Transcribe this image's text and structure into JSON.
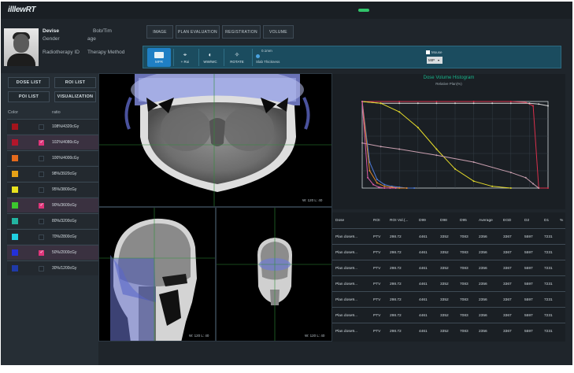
{
  "app": {
    "logo": "illlewRT"
  },
  "patient": {
    "name_label": "Devise",
    "name_value": "Bob/Tim",
    "gender_label": "Gender",
    "age_label": "age",
    "radiotherapy_id_label": "Radiotherapy ID",
    "therapy_method_label": "Therapy Method"
  },
  "nav": [
    "IMAGE",
    "PLAN EVALUATION",
    "REGISTRATION",
    "VOLUME"
  ],
  "toolbar": {
    "tools": [
      {
        "label": "MPR",
        "icon": "layout-icon"
      },
      {
        "label": "+ Roi",
        "icon": "crosshair-icon"
      },
      {
        "label": "WW/WC",
        "icon": "contrast-icon"
      },
      {
        "label": "ROTATE",
        "icon": "rotate-icon"
      }
    ],
    "slab_value": "0.1mm",
    "slab_label": "Slab Thickness",
    "mode_select": "MIP",
    "mouse_label": "Mouse"
  },
  "left": {
    "buttons": [
      "DOSE LIST",
      "ROI LIST",
      "POI LIST",
      "VISUALIZATION"
    ],
    "col_color": "Color",
    "col_ratio": "ratio",
    "dose_rows": [
      {
        "color": "#a4141c",
        "checked": false,
        "label": "108%/4320cGy"
      },
      {
        "color": "#b2162b",
        "checked": true,
        "label": "102%/4080cGy"
      },
      {
        "color": "#e46a1c",
        "checked": false,
        "label": "100%/4000cGy"
      },
      {
        "color": "#e6a117",
        "checked": false,
        "label": "98%/3920cGy"
      },
      {
        "color": "#e8e11e",
        "checked": false,
        "label": "95%/3800cGy"
      },
      {
        "color": "#3cc82e",
        "checked": true,
        "label": "90%/3600cGy"
      },
      {
        "color": "#22b4a0",
        "checked": false,
        "label": "80%/3200cGy"
      },
      {
        "color": "#20cfe0",
        "checked": false,
        "label": "70%/2800cGy"
      },
      {
        "color": "#2430d8",
        "checked": true,
        "label": "50%/2000cGy"
      },
      {
        "color": "#1f3aa8",
        "checked": false,
        "label": "30%/1200cGy"
      }
    ]
  },
  "viewports": {
    "axial_wl": "W: 120 L: 40",
    "sagittal_wl": "W: 120 L: 40",
    "coronal_wl": "W: 120 L: 40"
  },
  "chart": {
    "title": "Dose Volume Histogram",
    "subtitle": "Relative Plan(%)"
  },
  "chart_data": {
    "type": "line",
    "title": "Dose Volume Histogram",
    "subtitle": "Relative Plan(%)",
    "xlim": [
      0,
      100
    ],
    "ylim": [
      0,
      100
    ],
    "grid": true,
    "series": [
      {
        "color": "#d9304c",
        "x": [
          0,
          20,
          40,
          60,
          80,
          88,
          92,
          95,
          100
        ],
        "y": [
          100,
          100,
          100,
          100,
          100,
          99,
          95,
          0,
          0
        ]
      },
      {
        "color": "#d7d7d7",
        "x": [
          0,
          10,
          20,
          30,
          40,
          50,
          60,
          70,
          80,
          90,
          95,
          100
        ],
        "y": [
          100,
          98,
          98,
          98,
          98,
          98,
          98,
          98,
          98,
          98,
          97,
          95
        ]
      },
      {
        "color": "#e6dc2a",
        "x": [
          0,
          10,
          20,
          30,
          40,
          50,
          60,
          70,
          80
        ],
        "y": [
          100,
          98,
          88,
          70,
          45,
          22,
          8,
          2,
          0
        ]
      },
      {
        "color": "#caa0b0",
        "x": [
          0,
          10,
          20,
          40,
          60,
          80,
          88,
          92,
          95
        ],
        "y": [
          52,
          48,
          45,
          38,
          30,
          18,
          12,
          5,
          0
        ]
      },
      {
        "color": "#4f7bd6",
        "x": [
          0,
          4,
          8,
          12,
          16,
          20,
          24,
          28
        ],
        "y": [
          100,
          30,
          10,
          4,
          2,
          1,
          0,
          0
        ]
      },
      {
        "color": "#e3892a",
        "x": [
          0,
          4,
          8,
          12,
          16,
          20,
          24
        ],
        "y": [
          100,
          20,
          6,
          2,
          1,
          0,
          0
        ]
      },
      {
        "color": "#d85ca6",
        "x": [
          0,
          3,
          6,
          9,
          12,
          15,
          18
        ],
        "y": [
          100,
          12,
          4,
          1,
          0,
          0,
          0
        ]
      }
    ]
  },
  "table": {
    "headers": [
      "Dose",
      "ROI",
      "ROI Vol.(...",
      "D99",
      "D98",
      "D95",
      "Average",
      "EGD",
      "D2",
      "D1",
      "%"
    ],
    "rows": [
      [
        "Plan dose9...",
        "PTV",
        "298.72",
        "4461",
        "3352",
        "7083",
        "2356",
        "3367",
        "5597",
        "7231"
      ],
      [
        "Plan dose9...",
        "PTV",
        "298.72",
        "4461",
        "3352",
        "7083",
        "2356",
        "3367",
        "5597",
        "7231"
      ],
      [
        "Plan dose9...",
        "PTV",
        "298.72",
        "4461",
        "3352",
        "7083",
        "2356",
        "3367",
        "5597",
        "7231"
      ],
      [
        "Plan dose9...",
        "PTV",
        "298.72",
        "4461",
        "3352",
        "7083",
        "2356",
        "3367",
        "5597",
        "7231"
      ],
      [
        "Plan dose9...",
        "PTV",
        "298.72",
        "4461",
        "3352",
        "7083",
        "2356",
        "3367",
        "5597",
        "7231"
      ],
      [
        "Plan dose9...",
        "PTV",
        "298.72",
        "4461",
        "3352",
        "7083",
        "2356",
        "3367",
        "5597",
        "7231"
      ],
      [
        "Plan dose9...",
        "PTV",
        "298.72",
        "4461",
        "3352",
        "7083",
        "2356",
        "3367",
        "5597",
        "7231"
      ]
    ]
  }
}
